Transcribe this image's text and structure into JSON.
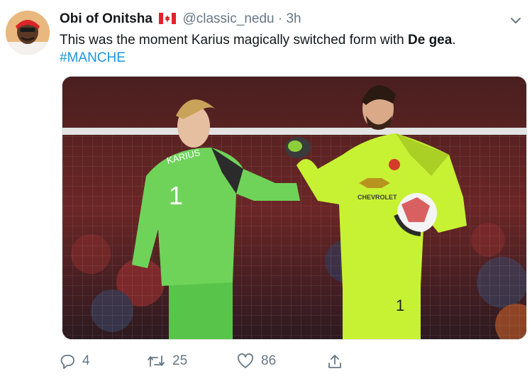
{
  "tweet": {
    "display_name": "Obi of Onitsha",
    "flag_icon": "canada-flag-icon",
    "handle": "@classic_nedu",
    "separator": "·",
    "time": "3h",
    "text_before": "This was the moment Karius magically switched form with ",
    "text_bold": "De gea",
    "text_after": ".",
    "hashtag": "#MANCHE"
  },
  "media": {
    "left_keeper_name": "KARIUS",
    "left_keeper_number": "1",
    "right_keeper_number": "1",
    "sponsor": "CHEVROLET"
  },
  "actions": {
    "reply_count": "4",
    "retweet_count": "25",
    "like_count": "86"
  },
  "colors": {
    "link": "#1b95e0",
    "muted": "#657786",
    "kit_left": "#6fd35a",
    "kit_right": "#c7f233"
  }
}
